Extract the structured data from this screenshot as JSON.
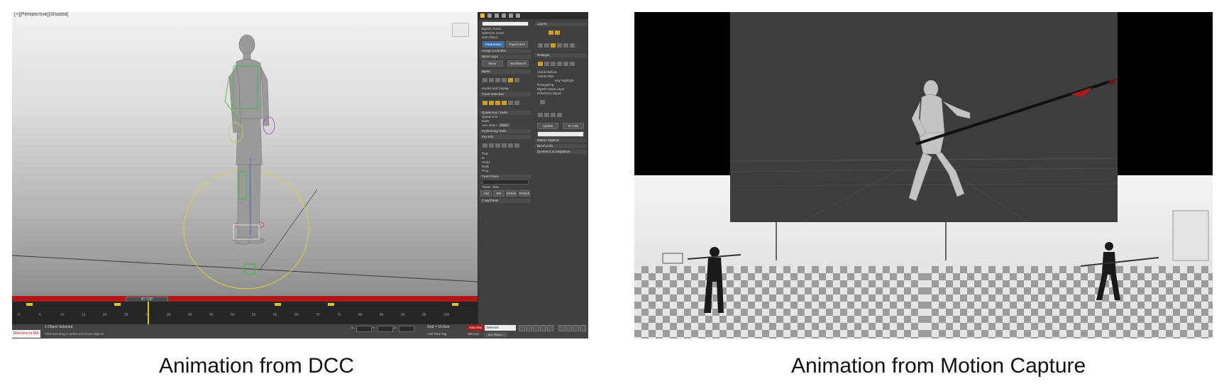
{
  "captions": {
    "left": "Animation from DCC",
    "right": "Animation from Motion Capture"
  },
  "dcc": {
    "viewport_label": "[+][Perspective][Shaded]",
    "timeline": {
      "slider_label": "8 / 100",
      "ticks": [
        "0",
        "5",
        "10",
        "15",
        "20",
        "25",
        "30",
        "35",
        "40",
        "45",
        "50",
        "55",
        "60",
        "65",
        "70",
        "75",
        "80",
        "85",
        "90",
        "95",
        "100"
      ]
    },
    "status": {
      "maxscript": "Welcome to MA",
      "selected": "1 Object Selected",
      "prompt": "Click and drag to select and move objects",
      "x": "X:",
      "y": "Y:",
      "z": "Z:",
      "grid": "Grid = 10.0cm",
      "add_time_tag": "Add Time Tag",
      "autokey": "Auto Key",
      "key_mode": "Selected",
      "set_key": "Set Key",
      "key_filters": "Key Filters..."
    },
    "command_panel": {
      "biped_name": "Bip001 Pelvis",
      "selection_level": "Selection Level:",
      "sub_object": "Sub-Object",
      "tab_parameters": "Parameters",
      "tab_trajectories": "Trajectories",
      "assign_controller": "Assign Controller",
      "biped_apps": "Biped Apps",
      "mixer": "Mixer",
      "workbench": "Workbench",
      "biped": "Biped",
      "modes_display": "Modes and Display",
      "track_selection": "Track Selection",
      "quaternion_euler": "Quaternion / Euler",
      "quaternion": "Quaternion",
      "euler": "Euler",
      "axis_order": "Axis Order:",
      "axis_order_value": "XYZ",
      "keyframing_tools": "Keyframing Tools",
      "key_info": "Key Info",
      "tcb": "TCB",
      "ik": "IK",
      "head": "Head",
      "body": "Body",
      "prop": "Prop",
      "twist_poses": "Twist Poses",
      "twists": "Twists",
      "bias": "Bias",
      "add": "Add",
      "set": "Set",
      "delete": "Delete",
      "default": "Default",
      "copy_paste": "Copy/Paste",
      "layers": "Layers",
      "retarget": "Retarget",
      "reference_layer": "Reference",
      "visible_before": "Visible Before",
      "visible_after": "Visible After",
      "key_highlight": "Key Highlight",
      "retargeting": "Retargeting",
      "bipeds_base_layer": "Biped's Base Layer",
      "reference_biped": "Reference Biped",
      "update": "Update",
      "ik_only": "IK Only",
      "motion_capture": "Motion Capture",
      "bend_links": "Bend Links",
      "dynamics_adaptation": "Dynamics & Adaptation"
    }
  }
}
